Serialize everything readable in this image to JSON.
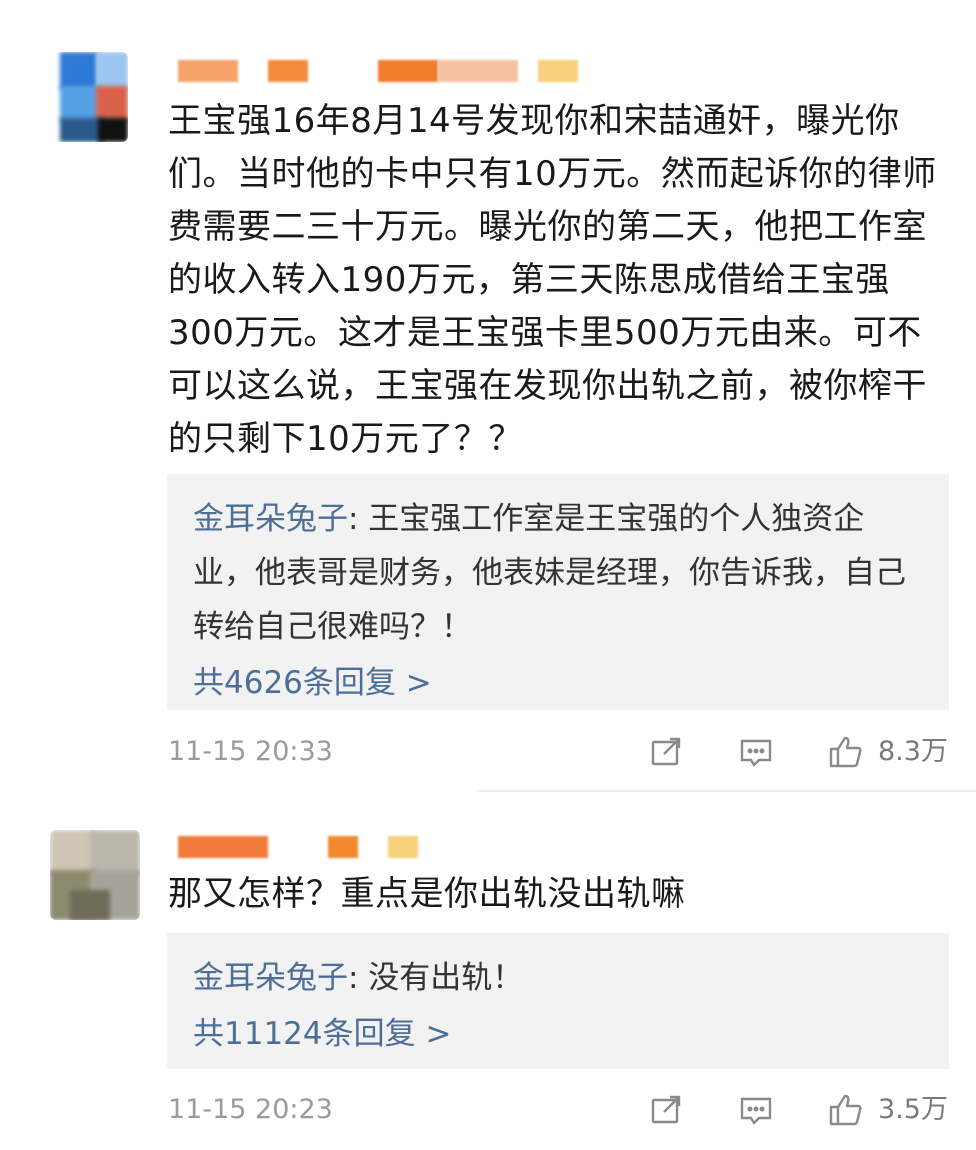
{
  "comments": [
    {
      "text": "王宝强16年8月14号发现你和宋喆通奸，曝光你们。当时他的卡中只有10万元。然而起诉你的律师费需要二三十万元。曝光你的第二天，他把工作室的收入转入190万元，第三天陈思成借给王宝强300万元。这才是王宝强卡里500万元由来。可不可以这么说，王宝强在发现你出轨之前，被你榨干的只剩下10万元了？？",
      "reply_author": "金耳朵兔子",
      "reply_text": ": 王宝强工作室是王宝强的个人独资企业，他表哥是财务，他表妹是经理，你告诉我，自己转给自己很难吗？！",
      "reply_count": "共4626条回复 >",
      "time": "11-15 20:33",
      "likes": "8.3万"
    },
    {
      "text": "那又怎样？重点是你出轨没出轨嘛",
      "reply_author": "金耳朵兔子",
      "reply_text": ": 没有出轨！",
      "reply_count": "共11124条回复 >",
      "time": "11-15 20:23",
      "likes": "3.5万"
    }
  ],
  "icons": {
    "share": "share-icon",
    "reply": "comment-icon",
    "like": "thumbs-up-icon"
  },
  "colors": {
    "link_blue": "#4c6e97",
    "reply_bg": "#f2f2f2",
    "meta_gray": "#9b9b9b"
  }
}
